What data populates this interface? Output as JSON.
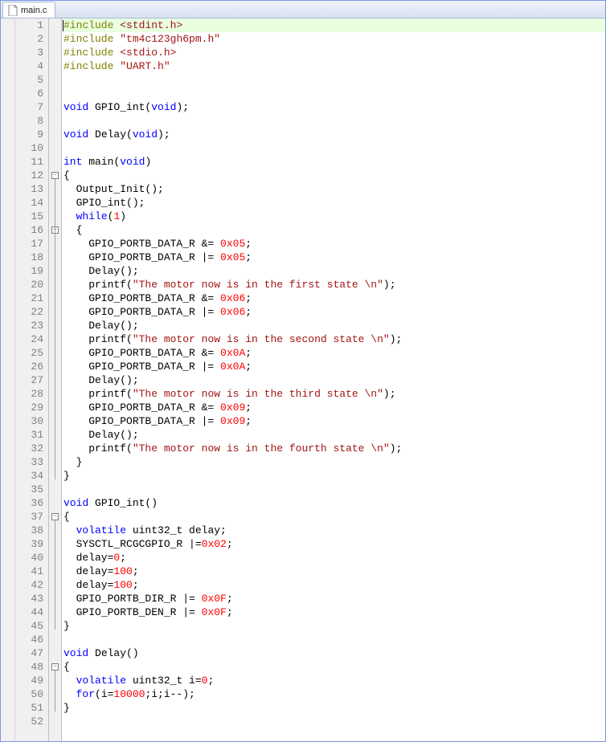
{
  "tab": {
    "filename": "main.c"
  },
  "line_count": 52,
  "fold_markers": [
    {
      "line": 12,
      "type": "open"
    },
    {
      "line": 16,
      "type": "open"
    },
    {
      "line": 37,
      "type": "open"
    },
    {
      "line": 48,
      "type": "open"
    }
  ],
  "highlighted_line": 1,
  "code_lines": [
    {
      "n": 1,
      "tokens": [
        [
          "pp",
          "#include"
        ],
        [
          "id",
          " "
        ],
        [
          "str",
          "<stdint.h>"
        ]
      ]
    },
    {
      "n": 2,
      "tokens": [
        [
          "pp",
          "#include"
        ],
        [
          "id",
          " "
        ],
        [
          "str",
          "\"tm4c123gh6pm.h\""
        ]
      ]
    },
    {
      "n": 3,
      "tokens": [
        [
          "pp",
          "#include"
        ],
        [
          "id",
          " "
        ],
        [
          "str",
          "<stdio.h>"
        ]
      ]
    },
    {
      "n": 4,
      "tokens": [
        [
          "pp",
          "#include"
        ],
        [
          "id",
          " "
        ],
        [
          "str",
          "\"UART.h\""
        ]
      ]
    },
    {
      "n": 5,
      "tokens": []
    },
    {
      "n": 6,
      "tokens": []
    },
    {
      "n": 7,
      "tokens": [
        [
          "kw",
          "void"
        ],
        [
          "id",
          " GPIO_int("
        ],
        [
          "kw",
          "void"
        ],
        [
          "id",
          ");"
        ]
      ]
    },
    {
      "n": 8,
      "tokens": []
    },
    {
      "n": 9,
      "tokens": [
        [
          "kw",
          "void"
        ],
        [
          "id",
          " Delay("
        ],
        [
          "kw",
          "void"
        ],
        [
          "id",
          ");"
        ]
      ]
    },
    {
      "n": 10,
      "tokens": []
    },
    {
      "n": 11,
      "tokens": [
        [
          "kw",
          "int"
        ],
        [
          "id",
          " main("
        ],
        [
          "kw",
          "void"
        ],
        [
          "id",
          ")"
        ]
      ]
    },
    {
      "n": 12,
      "tokens": [
        [
          "id",
          "{"
        ]
      ]
    },
    {
      "n": 13,
      "tokens": [
        [
          "id",
          "  Output_Init();"
        ]
      ]
    },
    {
      "n": 14,
      "tokens": [
        [
          "id",
          "  GPIO_int();"
        ]
      ]
    },
    {
      "n": 15,
      "tokens": [
        [
          "id",
          "  "
        ],
        [
          "kw",
          "while"
        ],
        [
          "id",
          "("
        ],
        [
          "num",
          "1"
        ],
        [
          "id",
          ")"
        ]
      ]
    },
    {
      "n": 16,
      "tokens": [
        [
          "id",
          "  {"
        ]
      ]
    },
    {
      "n": 17,
      "tokens": [
        [
          "id",
          "    GPIO_PORTB_DATA_R &= "
        ],
        [
          "num",
          "0x05"
        ],
        [
          "id",
          ";"
        ]
      ]
    },
    {
      "n": 18,
      "tokens": [
        [
          "id",
          "    GPIO_PORTB_DATA_R |= "
        ],
        [
          "num",
          "0x05"
        ],
        [
          "id",
          ";"
        ]
      ]
    },
    {
      "n": 19,
      "tokens": [
        [
          "id",
          "    Delay();"
        ]
      ]
    },
    {
      "n": 20,
      "tokens": [
        [
          "id",
          "    printf("
        ],
        [
          "str",
          "\"The motor now is in the first state \\n\""
        ],
        [
          "id",
          ");"
        ]
      ]
    },
    {
      "n": 21,
      "tokens": [
        [
          "id",
          "    GPIO_PORTB_DATA_R &= "
        ],
        [
          "num",
          "0x06"
        ],
        [
          "id",
          ";"
        ]
      ]
    },
    {
      "n": 22,
      "tokens": [
        [
          "id",
          "    GPIO_PORTB_DATA_R |= "
        ],
        [
          "num",
          "0x06"
        ],
        [
          "id",
          ";"
        ]
      ]
    },
    {
      "n": 23,
      "tokens": [
        [
          "id",
          "    Delay();"
        ]
      ]
    },
    {
      "n": 24,
      "tokens": [
        [
          "id",
          "    printf("
        ],
        [
          "str",
          "\"The motor now is in the second state \\n\""
        ],
        [
          "id",
          ");"
        ]
      ]
    },
    {
      "n": 25,
      "tokens": [
        [
          "id",
          "    GPIO_PORTB_DATA_R &= "
        ],
        [
          "num",
          "0x0A"
        ],
        [
          "id",
          ";"
        ]
      ]
    },
    {
      "n": 26,
      "tokens": [
        [
          "id",
          "    GPIO_PORTB_DATA_R |= "
        ],
        [
          "num",
          "0x0A"
        ],
        [
          "id",
          ";"
        ]
      ]
    },
    {
      "n": 27,
      "tokens": [
        [
          "id",
          "    Delay();"
        ]
      ]
    },
    {
      "n": 28,
      "tokens": [
        [
          "id",
          "    printf("
        ],
        [
          "str",
          "\"The motor now is in the third state \\n\""
        ],
        [
          "id",
          ");"
        ]
      ]
    },
    {
      "n": 29,
      "tokens": [
        [
          "id",
          "    GPIO_PORTB_DATA_R &= "
        ],
        [
          "num",
          "0x09"
        ],
        [
          "id",
          ";"
        ]
      ]
    },
    {
      "n": 30,
      "tokens": [
        [
          "id",
          "    GPIO_PORTB_DATA_R |= "
        ],
        [
          "num",
          "0x09"
        ],
        [
          "id",
          ";"
        ]
      ]
    },
    {
      "n": 31,
      "tokens": [
        [
          "id",
          "    Delay();"
        ]
      ]
    },
    {
      "n": 32,
      "tokens": [
        [
          "id",
          "    printf("
        ],
        [
          "str",
          "\"The motor now is in the fourth state \\n\""
        ],
        [
          "id",
          ");"
        ]
      ]
    },
    {
      "n": 33,
      "tokens": [
        [
          "id",
          "  }"
        ]
      ]
    },
    {
      "n": 34,
      "tokens": [
        [
          "id",
          "}"
        ]
      ]
    },
    {
      "n": 35,
      "tokens": []
    },
    {
      "n": 36,
      "tokens": [
        [
          "kw",
          "void"
        ],
        [
          "id",
          " GPIO_int()"
        ]
      ]
    },
    {
      "n": 37,
      "tokens": [
        [
          "id",
          "{"
        ]
      ]
    },
    {
      "n": 38,
      "tokens": [
        [
          "id",
          "  "
        ],
        [
          "kw",
          "volatile"
        ],
        [
          "id",
          " uint32_t delay;"
        ]
      ]
    },
    {
      "n": 39,
      "tokens": [
        [
          "id",
          "  SYSCTL_RCGCGPIO_R |="
        ],
        [
          "num",
          "0x02"
        ],
        [
          "id",
          ";"
        ]
      ]
    },
    {
      "n": 40,
      "tokens": [
        [
          "id",
          "  delay="
        ],
        [
          "num",
          "0"
        ],
        [
          "id",
          ";"
        ]
      ]
    },
    {
      "n": 41,
      "tokens": [
        [
          "id",
          "  delay="
        ],
        [
          "num",
          "100"
        ],
        [
          "id",
          ";"
        ]
      ]
    },
    {
      "n": 42,
      "tokens": [
        [
          "id",
          "  delay="
        ],
        [
          "num",
          "100"
        ],
        [
          "id",
          ";"
        ]
      ]
    },
    {
      "n": 43,
      "tokens": [
        [
          "id",
          "  GPIO_PORTB_DIR_R |= "
        ],
        [
          "num",
          "0x0F"
        ],
        [
          "id",
          ";"
        ]
      ]
    },
    {
      "n": 44,
      "tokens": [
        [
          "id",
          "  GPIO_PORTB_DEN_R |= "
        ],
        [
          "num",
          "0x0F"
        ],
        [
          "id",
          ";"
        ]
      ]
    },
    {
      "n": 45,
      "tokens": [
        [
          "id",
          "}"
        ]
      ]
    },
    {
      "n": 46,
      "tokens": []
    },
    {
      "n": 47,
      "tokens": [
        [
          "kw",
          "void"
        ],
        [
          "id",
          " Delay()"
        ]
      ]
    },
    {
      "n": 48,
      "tokens": [
        [
          "id",
          "{"
        ]
      ]
    },
    {
      "n": 49,
      "tokens": [
        [
          "id",
          "  "
        ],
        [
          "kw",
          "volatile"
        ],
        [
          "id",
          " uint32_t i="
        ],
        [
          "num",
          "0"
        ],
        [
          "id",
          ";"
        ]
      ]
    },
    {
      "n": 50,
      "tokens": [
        [
          "id",
          "  "
        ],
        [
          "kw",
          "for"
        ],
        [
          "id",
          "(i="
        ],
        [
          "num",
          "10000"
        ],
        [
          "id",
          ";i;i--);"
        ]
      ]
    },
    {
      "n": 51,
      "tokens": [
        [
          "id",
          "}"
        ]
      ]
    },
    {
      "n": 52,
      "tokens": []
    }
  ]
}
